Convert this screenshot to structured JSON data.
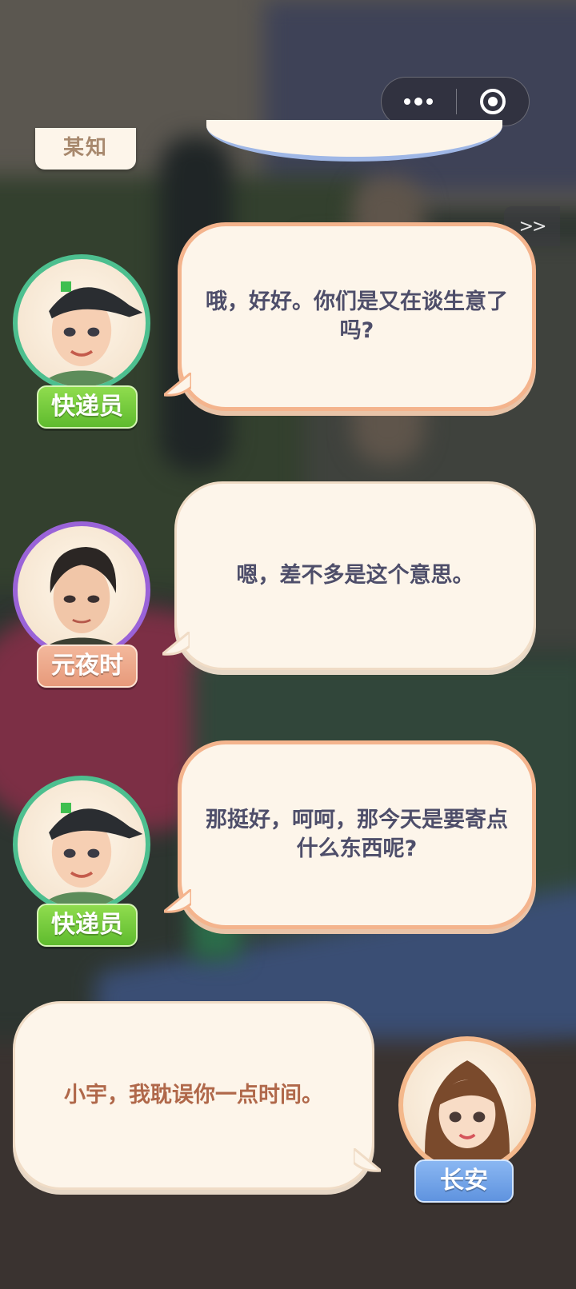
{
  "topbar": {
    "more_icon": "more-dots-icon",
    "close_icon": "target-close-icon",
    "skip_label": ">>"
  },
  "previous": {
    "speaker_fragment": "某知"
  },
  "dialogue": [
    {
      "speaker": "快递员",
      "text": "哦，好好。你们是又在谈生意了吗?",
      "side": "left",
      "ring_color": "#4dbf8f",
      "tag_color": "#6cc83a"
    },
    {
      "speaker": "元夜时",
      "text": "嗯，差不多是这个意思。",
      "side": "left",
      "ring_color": "#9a63d8",
      "tag_color": "#eba385"
    },
    {
      "speaker": "快递员",
      "text": "那挺好，呵呵，那今天是要寄点什么东西呢?",
      "side": "left",
      "ring_color": "#4dbf8f",
      "tag_color": "#6cc83a"
    },
    {
      "speaker": "长安",
      "text": "小宇，我耽误你一点时间。",
      "side": "right",
      "ring_color": "#f4b88b",
      "tag_color": "#6a9be3"
    }
  ]
}
